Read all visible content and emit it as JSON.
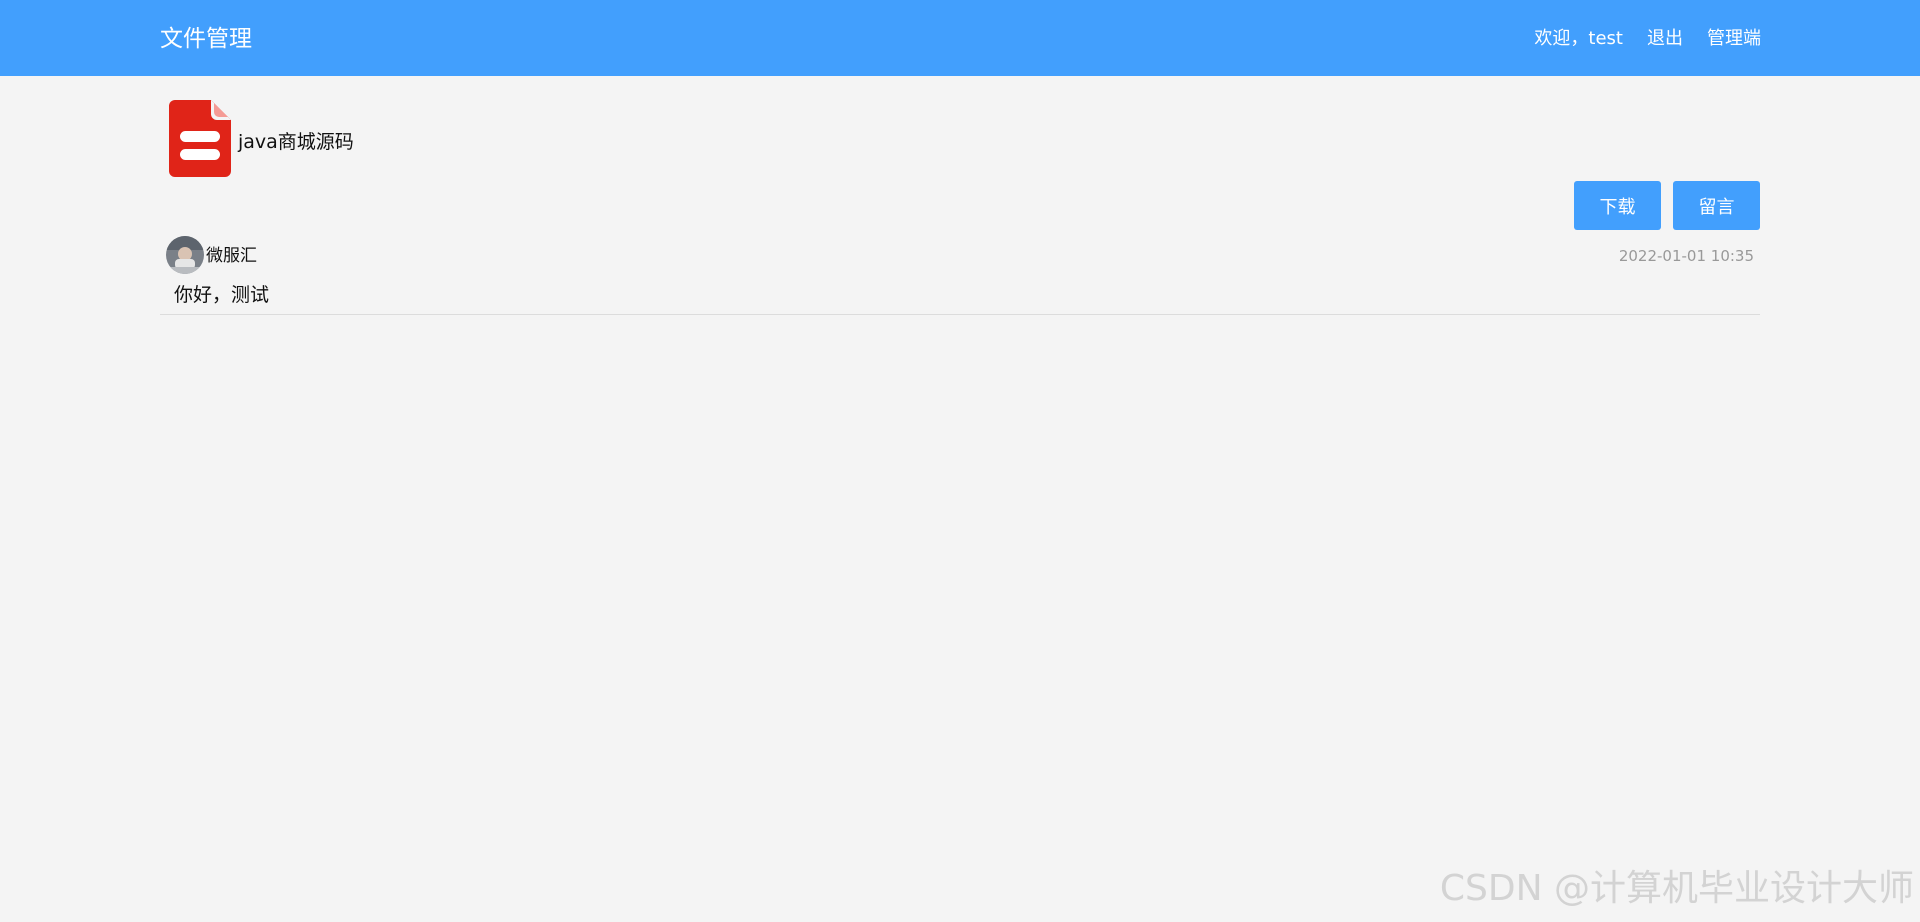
{
  "header": {
    "brand": "文件管理",
    "nav": {
      "welcome": "欢迎，test",
      "logout": "退出",
      "admin": "管理端"
    }
  },
  "file": {
    "icon": "document-icon",
    "name": "java商城源码"
  },
  "actions": {
    "download_label": "下载",
    "comment_label": "留言"
  },
  "comments": [
    {
      "author": "微服汇",
      "time": "2022-01-01 10:35",
      "text": "你好，测试",
      "avatar": "avatar-photo"
    }
  ],
  "watermark": "CSDN @计算机毕业设计大师",
  "colors": {
    "primary": "#429ffd",
    "background": "#f4f4f4",
    "file_icon": "#e02418"
  }
}
